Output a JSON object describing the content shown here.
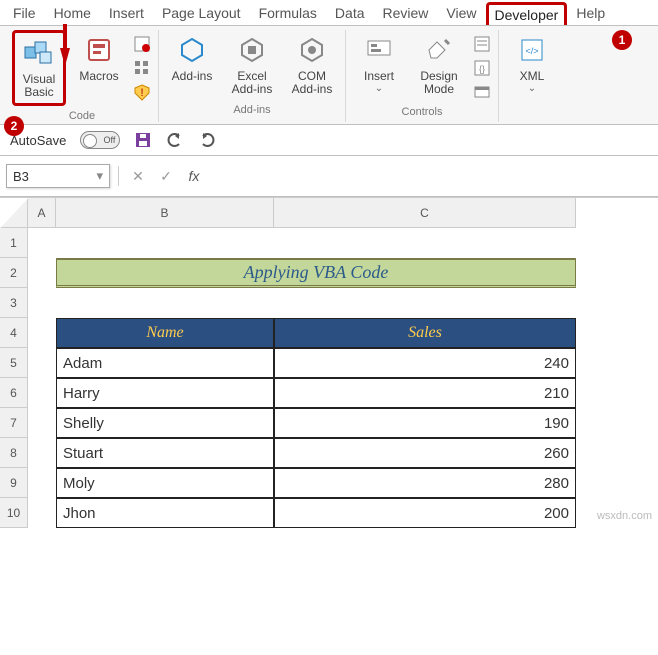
{
  "tabs": [
    "File",
    "Home",
    "Insert",
    "Page Layout",
    "Formulas",
    "Data",
    "Review",
    "View",
    "Developer",
    "Help"
  ],
  "active_tab": "Developer",
  "ribbon": {
    "code": {
      "label": "Code",
      "visual_basic": "Visual Basic",
      "macros": "Macros"
    },
    "addins": {
      "label": "Add-ins",
      "addins": "Add-ins",
      "excel_addins": "Excel Add-ins",
      "com_addins": "COM Add-ins"
    },
    "controls": {
      "label": "Controls",
      "insert": "Insert",
      "design_mode": "Design Mode"
    },
    "xml": {
      "label": "",
      "xml": "XML"
    }
  },
  "callouts": {
    "badge1": "1",
    "badge2": "2"
  },
  "qat": {
    "autosave": "AutoSave",
    "toggle": "Off"
  },
  "name_box": "B3",
  "columns": [
    "A",
    "B",
    "C"
  ],
  "rows": [
    "1",
    "2",
    "3",
    "4",
    "5",
    "6",
    "7",
    "8",
    "9",
    "10"
  ],
  "title": "Applying VBA Code",
  "headers": {
    "name": "Name",
    "sales": "Sales"
  },
  "data": [
    {
      "name": "Adam",
      "sales": "240"
    },
    {
      "name": "Harry",
      "sales": "210"
    },
    {
      "name": "Shelly",
      "sales": "190"
    },
    {
      "name": "Stuart",
      "sales": "260"
    },
    {
      "name": "Moly",
      "sales": "280"
    },
    {
      "name": "Jhon",
      "sales": "200"
    }
  ],
  "watermark": "wsxdn.com"
}
